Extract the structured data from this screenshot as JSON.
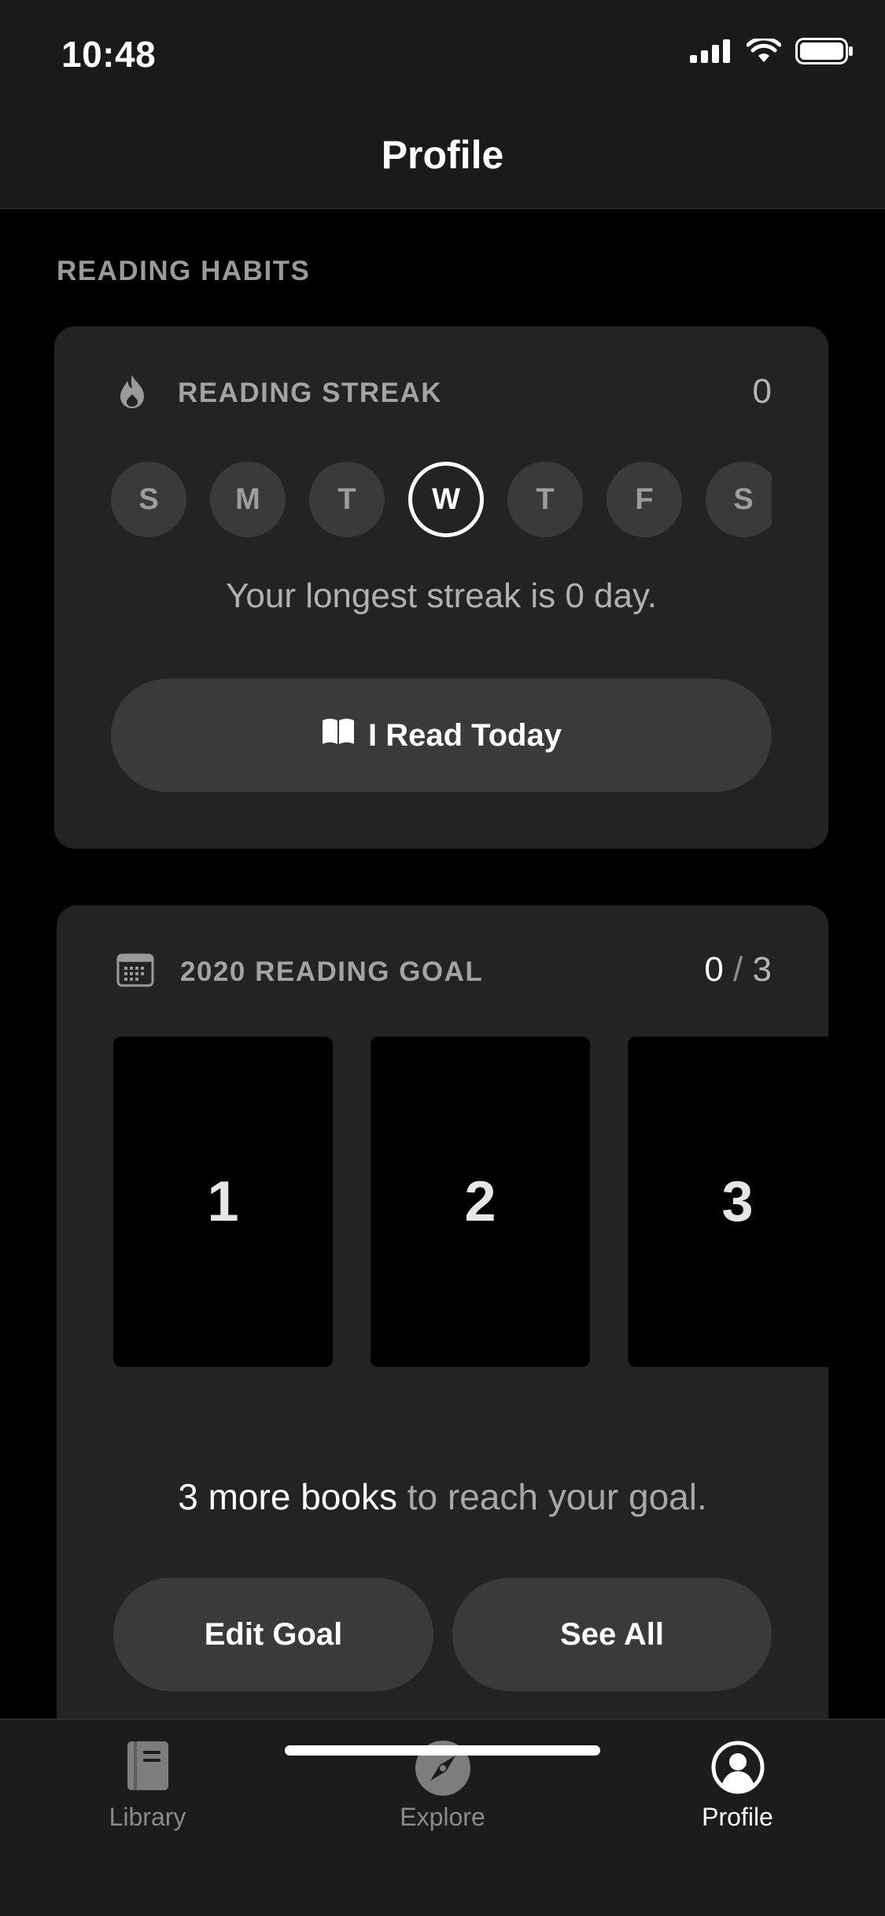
{
  "status_bar": {
    "time": "10:48",
    "icons": [
      "cellular-signal-icon",
      "wifi-icon",
      "battery-icon"
    ]
  },
  "nav": {
    "title": "Profile"
  },
  "section": {
    "label": "READING HABITS"
  },
  "streak_card": {
    "icon": "flame-icon",
    "label": "READING STREAK",
    "count": "0",
    "days": [
      {
        "letter": "S",
        "active": false
      },
      {
        "letter": "M",
        "active": false
      },
      {
        "letter": "T",
        "active": false
      },
      {
        "letter": "W",
        "active": true
      },
      {
        "letter": "T",
        "active": false
      },
      {
        "letter": "F",
        "active": false
      },
      {
        "letter": "S",
        "active": false
      }
    ],
    "longest_text": "Your longest streak is 0 day.",
    "read_button": {
      "icon": "open-book-icon",
      "label": "I Read Today"
    }
  },
  "goal_card": {
    "icon": "calendar-icon",
    "label": "2020 READING GOAL",
    "progress_current": "0",
    "progress_separator": " / ",
    "progress_total": "3",
    "books": [
      "1",
      "2",
      "3"
    ],
    "remaining_highlight": "3 more books",
    "remaining_rest": " to reach your goal.",
    "edit_button": "Edit Goal",
    "see_all_button": "See All"
  },
  "tab_bar": {
    "tabs": [
      {
        "label": "Library",
        "icon": "book-icon",
        "active": false
      },
      {
        "label": "Explore",
        "icon": "compass-icon",
        "active": false
      },
      {
        "label": "Profile",
        "icon": "user-circle-icon",
        "active": true
      }
    ]
  },
  "colors": {
    "background": "#000000",
    "card": "#232323",
    "button": "#3a3a3a",
    "muted_text": "#9a9a9a",
    "active": "#ffffff"
  }
}
